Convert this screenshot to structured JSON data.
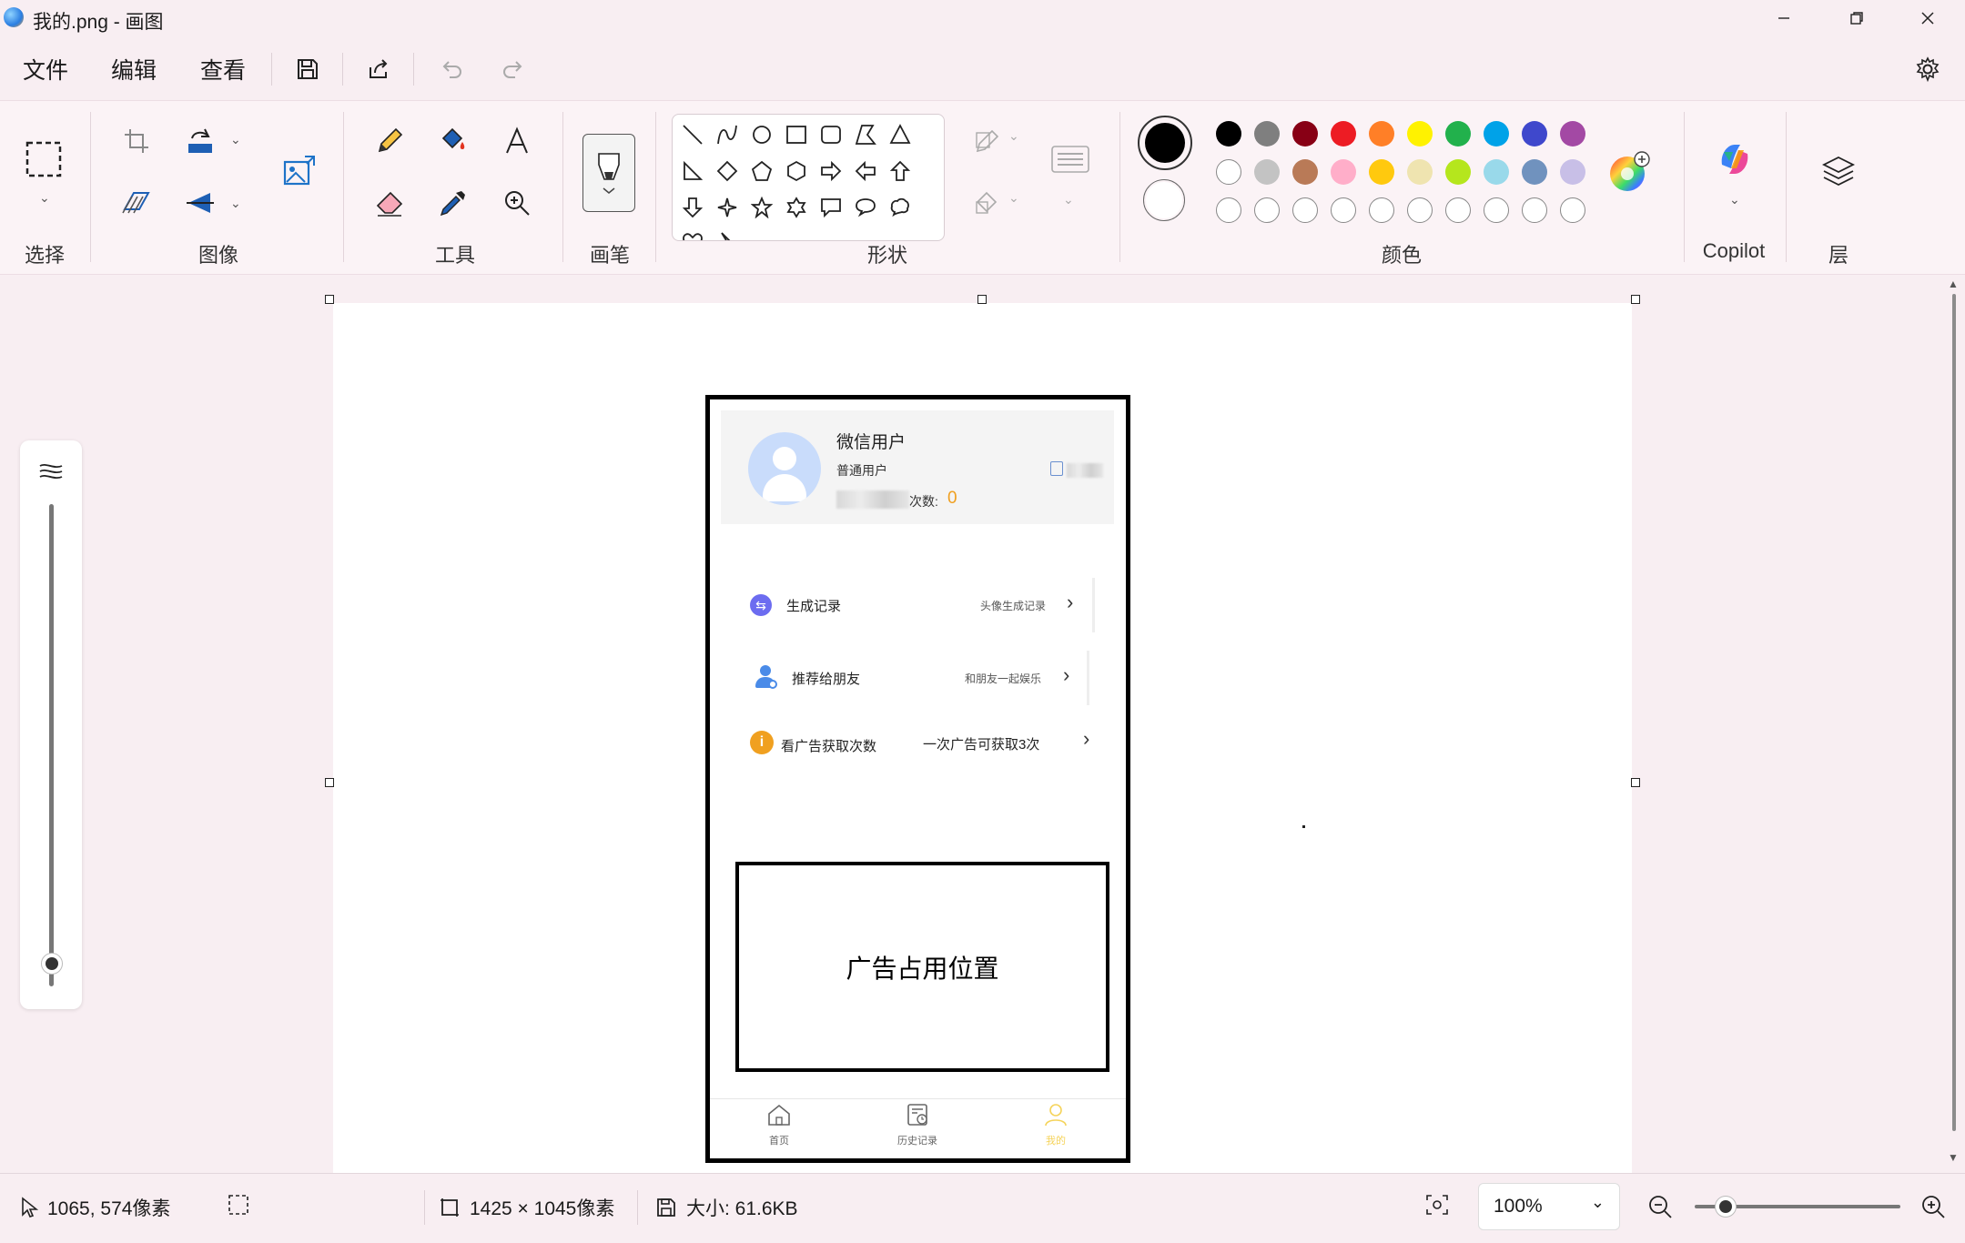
{
  "window": {
    "title": "我的.png - 画图",
    "app_icon": "paint-app-icon",
    "controls": [
      "minimize-icon",
      "maximize-icon",
      "close-icon"
    ]
  },
  "menu": {
    "file": "文件",
    "edit": "编辑",
    "view": "查看",
    "icons": [
      "save-icon",
      "share-icon",
      "undo-icon",
      "redo-icon",
      "settings-icon"
    ]
  },
  "ribbon": {
    "groups": {
      "select": "选择",
      "image": "图像",
      "tools": "工具",
      "brush": "画笔",
      "shapes": "形状",
      "colors": "颜色",
      "copilot": "Copilot",
      "layers": "层"
    },
    "selected_color": "#000000",
    "secondary_color": "#ffffff",
    "palette_row1": [
      "#000000",
      "#7f7f7f",
      "#880015",
      "#ed1c24",
      "#ff7f27",
      "#fff200",
      "#22b14c",
      "#00a2e8",
      "#3f48cc",
      "#a349a4"
    ],
    "palette_row2": [
      "#ffffff",
      "#c3c3c3",
      "#b97a57",
      "#ffaec9",
      "#ffc90e",
      "#efe4b0",
      "#b5e61d",
      "#99d9ea",
      "#7092be",
      "#c8bfe7"
    ],
    "palette_row3_custom_slots": 10
  },
  "phone": {
    "username": "微信用户",
    "user_type": "普通用户",
    "count_label": "次数:",
    "count_value": "0",
    "rows": [
      {
        "label": "生成记录",
        "sub": "头像生成记录"
      },
      {
        "label": "推荐给朋友",
        "sub": "和朋友一起娱乐"
      },
      {
        "label": "看广告获取次数",
        "sub": "一次广告可获取3次"
      }
    ],
    "ad_text": "广告占用位置",
    "tabs": [
      {
        "label": "首页",
        "icon": "home-icon"
      },
      {
        "label": "历史记录",
        "icon": "history-icon"
      },
      {
        "label": "我的",
        "icon": "profile-icon"
      }
    ],
    "accent_color": "#f0a020",
    "active_tab_color": "#f5d35a"
  },
  "status": {
    "cursor_pos": "1065, 574像素",
    "image_dims": "1425 × 1045像素",
    "file_size": "大小: 61.6KB",
    "zoom": "100%",
    "zoom_level": 100
  }
}
